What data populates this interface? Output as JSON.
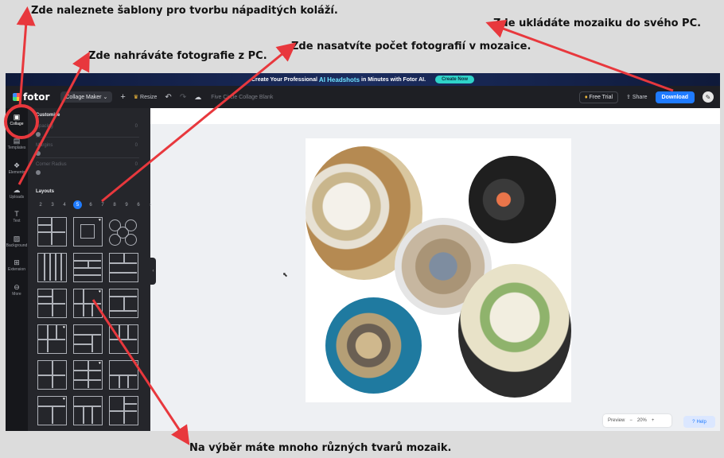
{
  "annotations": {
    "templates": "Zde naleznete šablony pro tvorbu nápaditých koláží.",
    "upload": "Zde nahráváte fotografie z PC.",
    "count": "Zde nasatvíte počet fotografií v mozaice.",
    "download": "Zde ukládáte mozaiku do svého PC.",
    "shapes": "Na výběr máte mnoho různých tvarů mozaik."
  },
  "banner": {
    "text_pre": "Create Your Professional",
    "highlight": "AI Headshots",
    "text_post": "in Minutes with Fotor AI.",
    "cta": "Create Now"
  },
  "topbar": {
    "logo": "fotor",
    "mode": "Collage Maker",
    "mode_icon": "chevron-down-icon",
    "resize": "Resize",
    "title": "Five Circle Collage Blank",
    "free_trial": "Free Trial",
    "share": "Share",
    "download": "Download",
    "user_initial": "✎"
  },
  "rail": [
    {
      "label": "Collage",
      "icon": "▣"
    },
    {
      "label": "Templates",
      "icon": "▤"
    },
    {
      "label": "Elements",
      "icon": "❖"
    },
    {
      "label": "Uploads",
      "icon": "☁"
    },
    {
      "label": "Text",
      "icon": "T"
    },
    {
      "label": "Background",
      "icon": "▨"
    },
    {
      "label": "Extension",
      "icon": "⊞"
    },
    {
      "label": "More",
      "icon": "⊖"
    }
  ],
  "panel": {
    "customize": "Customize",
    "spacing": "Spacing",
    "spacing_value": "0",
    "margins": "Margins",
    "margins_value": "0",
    "corner": "Corner Radius",
    "corner_value": "0",
    "layouts": "Layouts",
    "counts": [
      "2",
      "3",
      "4",
      "5",
      "6",
      "7",
      "8",
      "9",
      "6"
    ],
    "selected_count": "5",
    "next": "›"
  },
  "zoom": {
    "preview": "Preview",
    "minus": "−",
    "value": "20%",
    "plus": "+"
  },
  "help": "Help",
  "colors": {
    "accent": "#1f7bff",
    "annotation": "#e8383d"
  }
}
